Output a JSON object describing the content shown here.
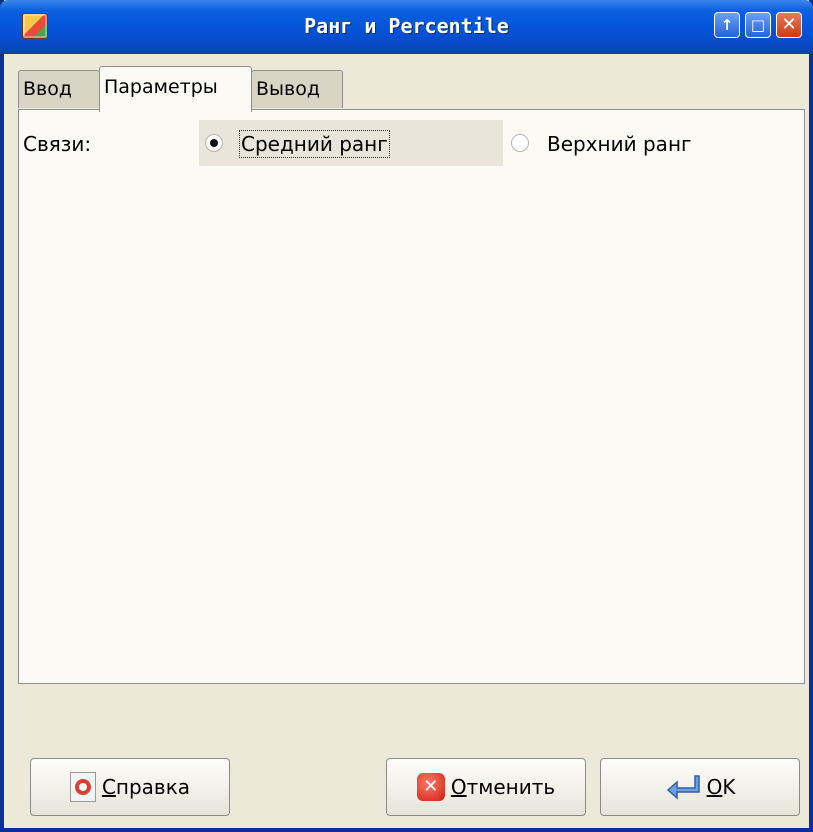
{
  "window": {
    "title": "Ранг и Percentile",
    "controls": {
      "minimize": "↑",
      "maximize": "□",
      "close": "✕"
    }
  },
  "tabs": [
    {
      "label": "Ввод",
      "active": false
    },
    {
      "label": "Параметры",
      "active": true
    },
    {
      "label": "Вывод",
      "active": false
    }
  ],
  "parameters": {
    "ties_label": "Связи:",
    "options": [
      {
        "label": "Средний ранг",
        "selected": true
      },
      {
        "label": "Верхний ранг",
        "selected": false
      }
    ]
  },
  "buttons": {
    "help": {
      "mnemonic": "С",
      "rest": "правка"
    },
    "cancel": {
      "mnemonic": "О",
      "rest": "тменить"
    },
    "ok": {
      "mnemonic": "O",
      "rest": "K"
    }
  },
  "icons": {
    "app": "spreadsheet-icon",
    "help": "lifebuoy-icon",
    "cancel": "cancel-icon",
    "ok": "enter-arrow-icon"
  }
}
